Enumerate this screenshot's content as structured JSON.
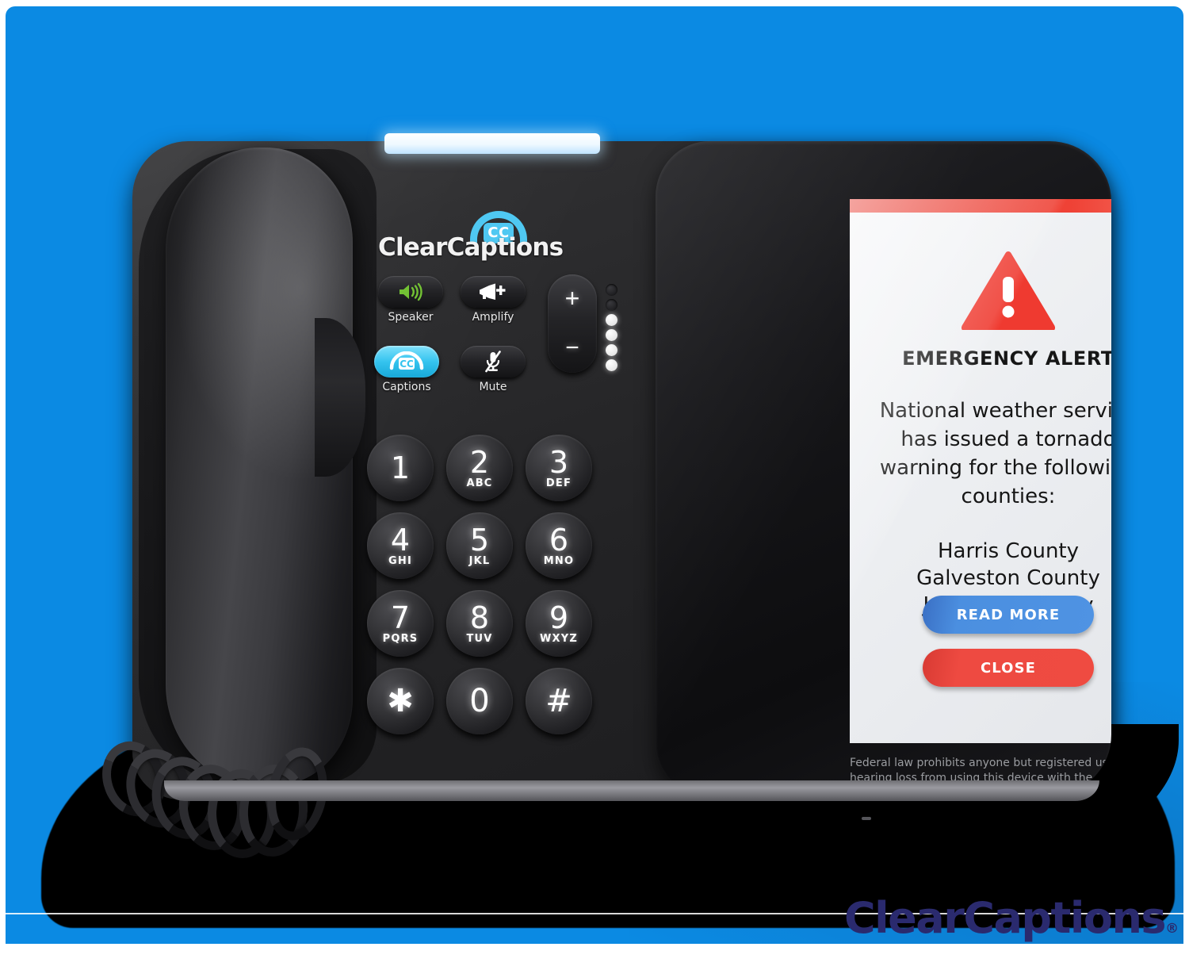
{
  "theme": {
    "background_blue": "#0b8ae3",
    "alert_red": "#ef4a41",
    "action_blue": "#4f93e3",
    "captions_cyan": "#35c4ef",
    "logo_navy": "#2a2a6e"
  },
  "device": {
    "brand_logo": {
      "wordmark": "ClearCaptions",
      "badge_text": "CC",
      "icon": "cc-handset-badge-icon"
    },
    "function_buttons": [
      {
        "id": "speaker",
        "label": "Speaker",
        "icon": "speaker-icon",
        "active": false
      },
      {
        "id": "amplify",
        "label": "Amplify",
        "icon": "megaphone-plus-icon",
        "active": false
      },
      {
        "id": "captions",
        "label": "Captions",
        "icon": "cc-icon",
        "active": true
      },
      {
        "id": "mute",
        "label": "Mute",
        "icon": "mic-muted-icon",
        "active": false
      }
    ],
    "volume_rocker": {
      "increase": "+",
      "decrease": "−"
    },
    "volume_leds": [
      false,
      false,
      true,
      true,
      true,
      true
    ],
    "keypad": [
      {
        "num": "1",
        "letters": ""
      },
      {
        "num": "2",
        "letters": "ABC"
      },
      {
        "num": "3",
        "letters": "DEF"
      },
      {
        "num": "4",
        "letters": "GHI"
      },
      {
        "num": "5",
        "letters": "JKL"
      },
      {
        "num": "6",
        "letters": "MNO"
      },
      {
        "num": "7",
        "letters": "PQRS"
      },
      {
        "num": "8",
        "letters": "TUV"
      },
      {
        "num": "9",
        "letters": "WXYZ"
      },
      {
        "num": "✱",
        "letters": ""
      },
      {
        "num": "0",
        "letters": ""
      },
      {
        "num": "#",
        "letters": ""
      }
    ],
    "disclaimer": "Federal law prohibits anyone but registered users with hearing loss from using this device with the captions on."
  },
  "screen": {
    "alert": {
      "icon": "warning-triangle-icon",
      "title": "EMERGENCY ALERT",
      "message": "National weather service has issued a tornado warning for the following counties:",
      "counties": [
        "Harris County",
        "Galveston County",
        "Jefferson County"
      ],
      "primary_button": "READ MORE",
      "secondary_button": "CLOSE"
    }
  },
  "watermark": {
    "wordmark": "ClearCaptions",
    "registered_mark": "®"
  }
}
